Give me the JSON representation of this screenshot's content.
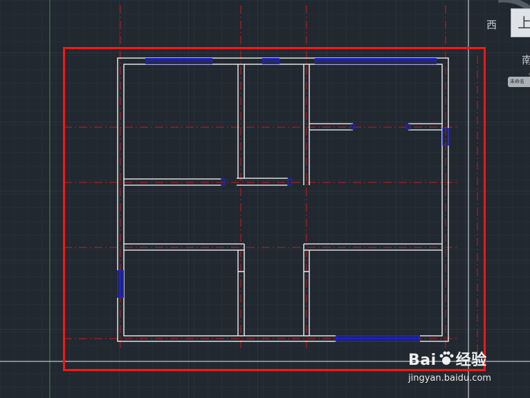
{
  "viewcube": {
    "west_label": "西",
    "south_label": "南",
    "face_label": "上",
    "wcs_label": "未命名"
  },
  "watermark": {
    "brand": "Bai",
    "brand_suffix": "经验",
    "url": "jingyan.baidu.com"
  },
  "colors": {
    "background": "#212830",
    "grid_minor": "#2b333d",
    "grid_major": "#36404b",
    "wall": "#ffffff",
    "axis_line": "#c81e1e",
    "window": "#1f22c6",
    "highlight_frame": "#ff1414",
    "ucs_green": "#3e8b3e"
  },
  "drawing": {
    "description_visible": false
  }
}
